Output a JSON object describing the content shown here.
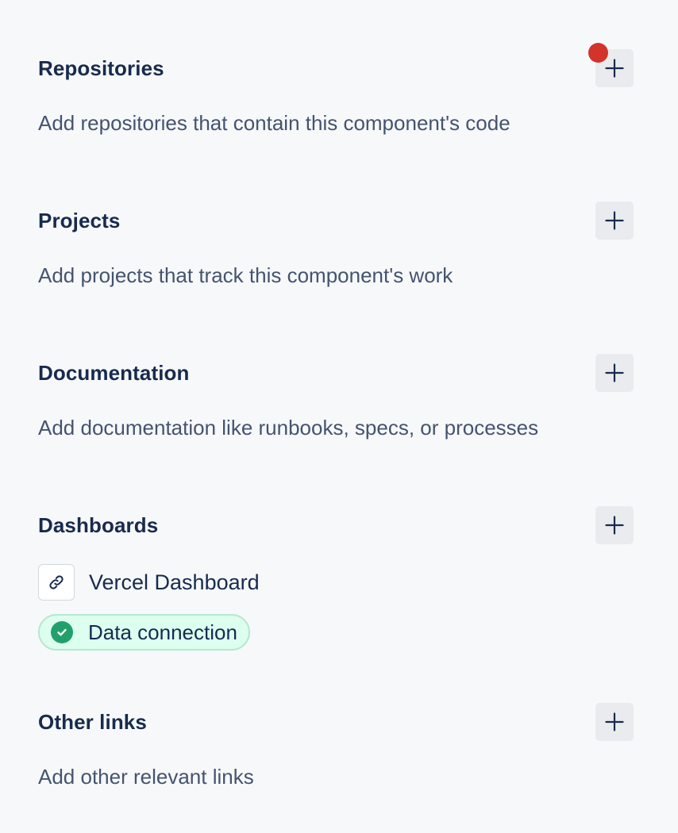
{
  "sections": {
    "repositories": {
      "title": "Repositories",
      "description": "Add repositories that contain this component's code",
      "add_icon": "plus-icon",
      "has_notification": true
    },
    "projects": {
      "title": "Projects",
      "description": "Add projects that track this component's work",
      "add_icon": "plus-icon"
    },
    "documentation": {
      "title": "Documentation",
      "description": "Add documentation like runbooks, specs, or processes",
      "add_icon": "plus-icon"
    },
    "dashboards": {
      "title": "Dashboards",
      "add_icon": "plus-icon",
      "items": [
        {
          "icon": "link-icon",
          "label": "Vercel Dashboard",
          "status": {
            "icon": "check-circle-icon",
            "label": "Data connection",
            "color": "#22a06b"
          }
        }
      ]
    },
    "other_links": {
      "title": "Other links",
      "description": "Add other relevant links",
      "add_icon": "plus-icon"
    }
  },
  "colors": {
    "background": "#f7f8fa",
    "title": "#172b4d",
    "description": "#44546f",
    "button_bg": "#e9ebee",
    "notification_dot": "#d2342a",
    "success_bg": "#dcfff0",
    "success_border": "#b5e8cf",
    "success_icon": "#22a06b"
  }
}
